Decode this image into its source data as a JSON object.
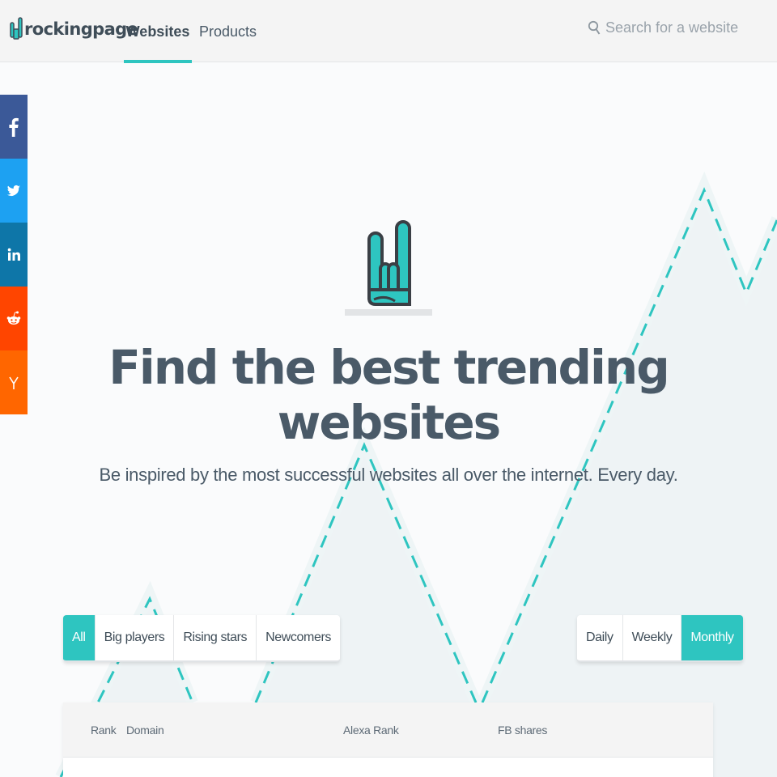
{
  "header": {
    "logo_text": "rockingpage",
    "nav": [
      {
        "label": "Websites",
        "active": true
      },
      {
        "label": "Products",
        "active": false
      }
    ],
    "search_placeholder": "Search for a website"
  },
  "social": [
    {
      "name": "facebook",
      "icon": "facebook-icon",
      "color": "#3b5998"
    },
    {
      "name": "twitter",
      "icon": "twitter-icon",
      "color": "#1da1f2"
    },
    {
      "name": "linkedin",
      "icon": "linkedin-icon",
      "color": "#0e76a8"
    },
    {
      "name": "reddit",
      "icon": "reddit-icon",
      "color": "#ff4500"
    },
    {
      "name": "hacker-news",
      "icon": "y-combinator-icon",
      "color": "#ff6600"
    }
  ],
  "hero": {
    "title": "Find the best trending websites",
    "subtitle": "Be inspired by the most successful websites all over the internet. Every day."
  },
  "filters": {
    "category": [
      "All",
      "Big players",
      "Rising stars",
      "Newcomers"
    ],
    "category_active": "All",
    "period": [
      "Daily",
      "Weekly",
      "Monthly"
    ],
    "period_active": "Monthly"
  },
  "table": {
    "headers": [
      "Rank",
      "Domain",
      "Alexa Rank",
      "FB shares"
    ]
  },
  "colors": {
    "accent": "#2ec5c0",
    "text": "#4a5a68",
    "header_bg": "#f4f4f4"
  }
}
